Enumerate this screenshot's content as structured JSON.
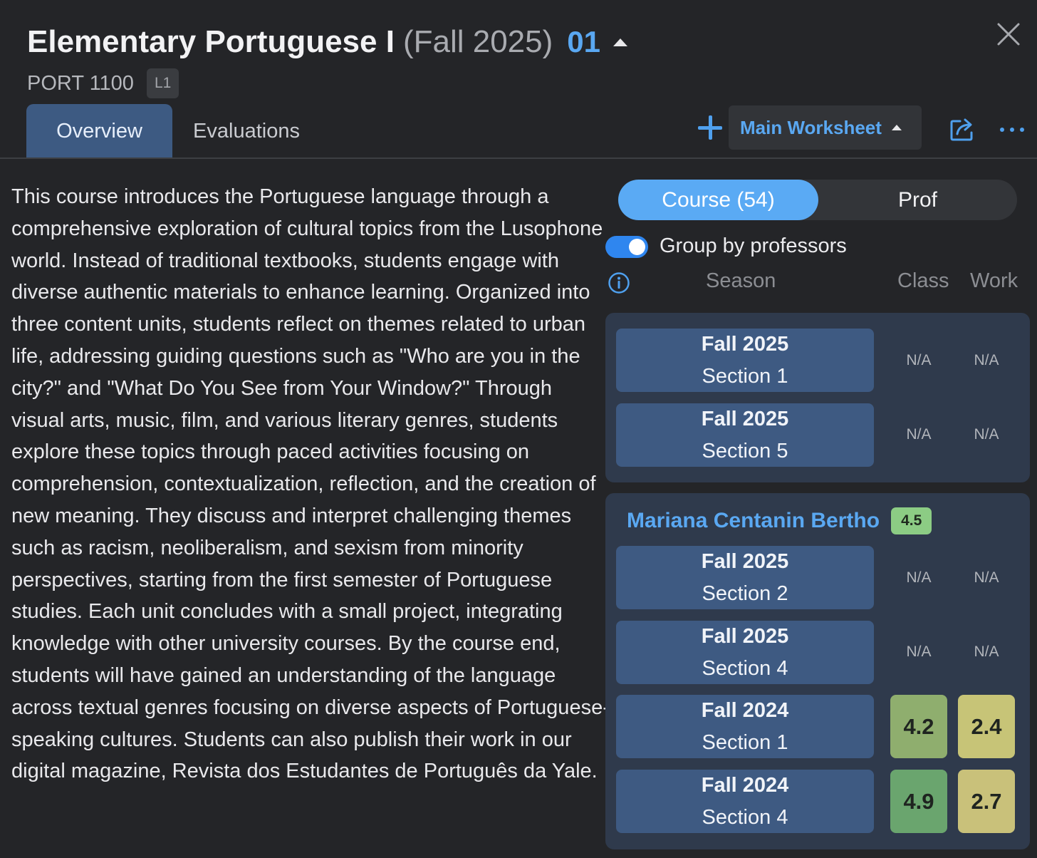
{
  "header": {
    "course_name": "Elementary Portuguese I",
    "term": "(Fall 2025)",
    "section_number": "01",
    "course_code": "PORT 1100",
    "level_badge": "L1"
  },
  "tabs": [
    {
      "label": "Overview",
      "active": true
    },
    {
      "label": "Evaluations",
      "active": false
    }
  ],
  "toolbar": {
    "worksheet_label": "Main Worksheet"
  },
  "description": "This course introduces the Portuguese language through a comprehensive exploration of cultural topics from the Lusophone world. Instead of traditional textbooks, students engage with diverse authentic materials to enhance learning. Organized into three content units, students reflect on themes related to urban life, addressing guiding questions such as \"Who are you in the city?\" and \"What Do You See from Your Window?\" Through visual arts, music, film, and various literary genres, students explore these topics through paced activities focusing on comprehension, contextualization, reflection, and the creation of new meaning. They discuss and interpret challenging themes such as racism, neoliberalism, and sexism from minority perspectives, starting from the first semester of Portuguese studies. Each unit concludes with a small project, integrating knowledge with other university courses. By the course end, students will have gained an understanding of the language across textual genres focusing on diverse aspects of Portuguese-speaking cultures. Students can also publish their work in our digital magazine, Revista dos Estudantes de Português da Yale.",
  "ratings_panel": {
    "segments": {
      "course": "Course (54)",
      "prof": "Prof",
      "selected": "course"
    },
    "group_by_label": "Group by professors",
    "group_by_enabled": true,
    "columns": {
      "season": "Season",
      "class": "Class",
      "work": "Work"
    },
    "groups": [
      {
        "rows": [
          {
            "term": "Fall 2025",
            "section": "Section 1",
            "class": "N/A",
            "work": "N/A"
          },
          {
            "term": "Fall 2025",
            "section": "Section 5",
            "class": "N/A",
            "work": "N/A"
          }
        ]
      },
      {
        "professor": "Mariana Centanin Bertho",
        "professor_rating": "4.5",
        "rows": [
          {
            "term": "Fall 2025",
            "section": "Section 2",
            "class": "N/A",
            "work": "N/A"
          },
          {
            "term": "Fall 2025",
            "section": "Section 4",
            "class": "N/A",
            "work": "N/A"
          },
          {
            "term": "Fall 2024",
            "section": "Section 1",
            "class": "4.2",
            "work": "2.4",
            "class_color": "#8fae6e",
            "work_color": "#c7c477"
          },
          {
            "term": "Fall 2024",
            "section": "Section 4",
            "class": "4.9",
            "work": "2.7",
            "class_color": "#6aa56e",
            "work_color": "#c9c17a"
          }
        ]
      }
    ]
  },
  "colors": {
    "accent_blue": "#5aa8f2",
    "tab_active": "#3d5a82",
    "background": "#242528",
    "group_card": "#2f3a4c",
    "prof_rating_bg": "#8ccc84"
  },
  "icons": [
    "close-icon",
    "caret-up-icon",
    "plus-icon",
    "share-icon",
    "more-icon",
    "info-icon"
  ]
}
